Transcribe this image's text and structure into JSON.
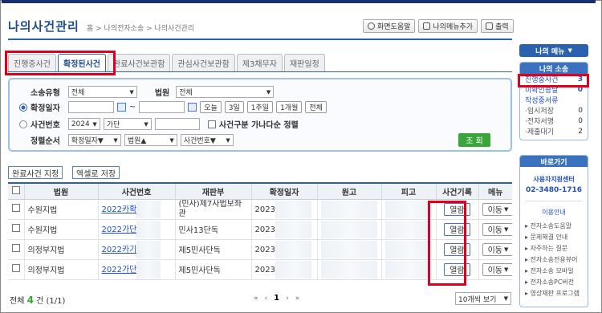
{
  "header": {
    "title": "나의사건관리",
    "breadcrumb": "홈 > 나의전자소송 > 나의사건관리",
    "buttons": [
      "화면도움말",
      "나의메뉴추가",
      "출력"
    ]
  },
  "tabs": [
    "진행중사건",
    "확정된사건",
    "완료사건보관함",
    "관심사건보관함",
    "제3채무자",
    "재판일정"
  ],
  "active_tab": "확정된사건",
  "search": {
    "case_type_label": "소송유형",
    "case_type_value": "전체",
    "court_label": "법원",
    "court_value": "전체",
    "confirm_date_label": "확정일자",
    "tilde": "~",
    "date_buttons": [
      "오늘",
      "3일",
      "1주일",
      "1개월",
      "전체"
    ],
    "case_no_label": "사건번호",
    "year_value": "2024",
    "type_value": "가단",
    "group_label": "사건구분 가나다순 정렬",
    "sort_label": "정렬순서",
    "sort_values": [
      "확정일자▼",
      "법원▲",
      "사건번호▼"
    ],
    "go_button": "조 회"
  },
  "actions": [
    "완료사건 지정",
    "엑셀로 저장"
  ],
  "table": {
    "headers": [
      "",
      "법원",
      "사건번호",
      "재판부",
      "확정일자",
      "원고",
      "피고",
      "사건기록",
      "메뉴"
    ],
    "rows": [
      {
        "court": "수원지법",
        "case_no": "2022카확",
        "division": "(민사)제7사법보좌관",
        "date": "2023",
        "view": "열람",
        "menu": "이동"
      },
      {
        "court": "수원지법",
        "case_no": "2022가단",
        "division": "민사13단독",
        "date": "2023",
        "view": "열람",
        "menu": "이동"
      },
      {
        "court": "의정부지법",
        "case_no": "2022카기",
        "division": "제5민사단독",
        "date": "2023",
        "view": "열람",
        "menu": "이동"
      },
      {
        "court": "의정부지법",
        "case_no": "2022가단",
        "division": "제5민사단독",
        "date": "2023",
        "view": "열람",
        "menu": "이동"
      }
    ]
  },
  "footer": {
    "total_prefix": "전체",
    "total_count": "4",
    "total_suffix": "건 (1/1)",
    "page": "1",
    "per_page": "10개씩 보기"
  },
  "side": {
    "my_menu": "나의 메뉴",
    "my_case_title": "나의 소송",
    "items": [
      {
        "label": "진행중사건",
        "count": "3"
      },
      {
        "label": "미확인송달",
        "count": "0"
      },
      {
        "label": "작성중서류",
        "count": ""
      },
      {
        "label": "·임시저장",
        "count": "0"
      },
      {
        "label": "·전자서명",
        "count": "0"
      },
      {
        "label": "·제출대기",
        "count": "2"
      }
    ],
    "shortcut_title": "바로가기",
    "support_center": "사용자지원센터",
    "phone": "02-3480-1716",
    "guide": "이용안내",
    "links": [
      "전자소송도움말",
      "문제해결 안내",
      "자주하는 질문",
      "전자소송전용뷰어",
      "전자소송 모바일",
      "전자소송PC버전",
      "영상재판 프로그램"
    ]
  }
}
